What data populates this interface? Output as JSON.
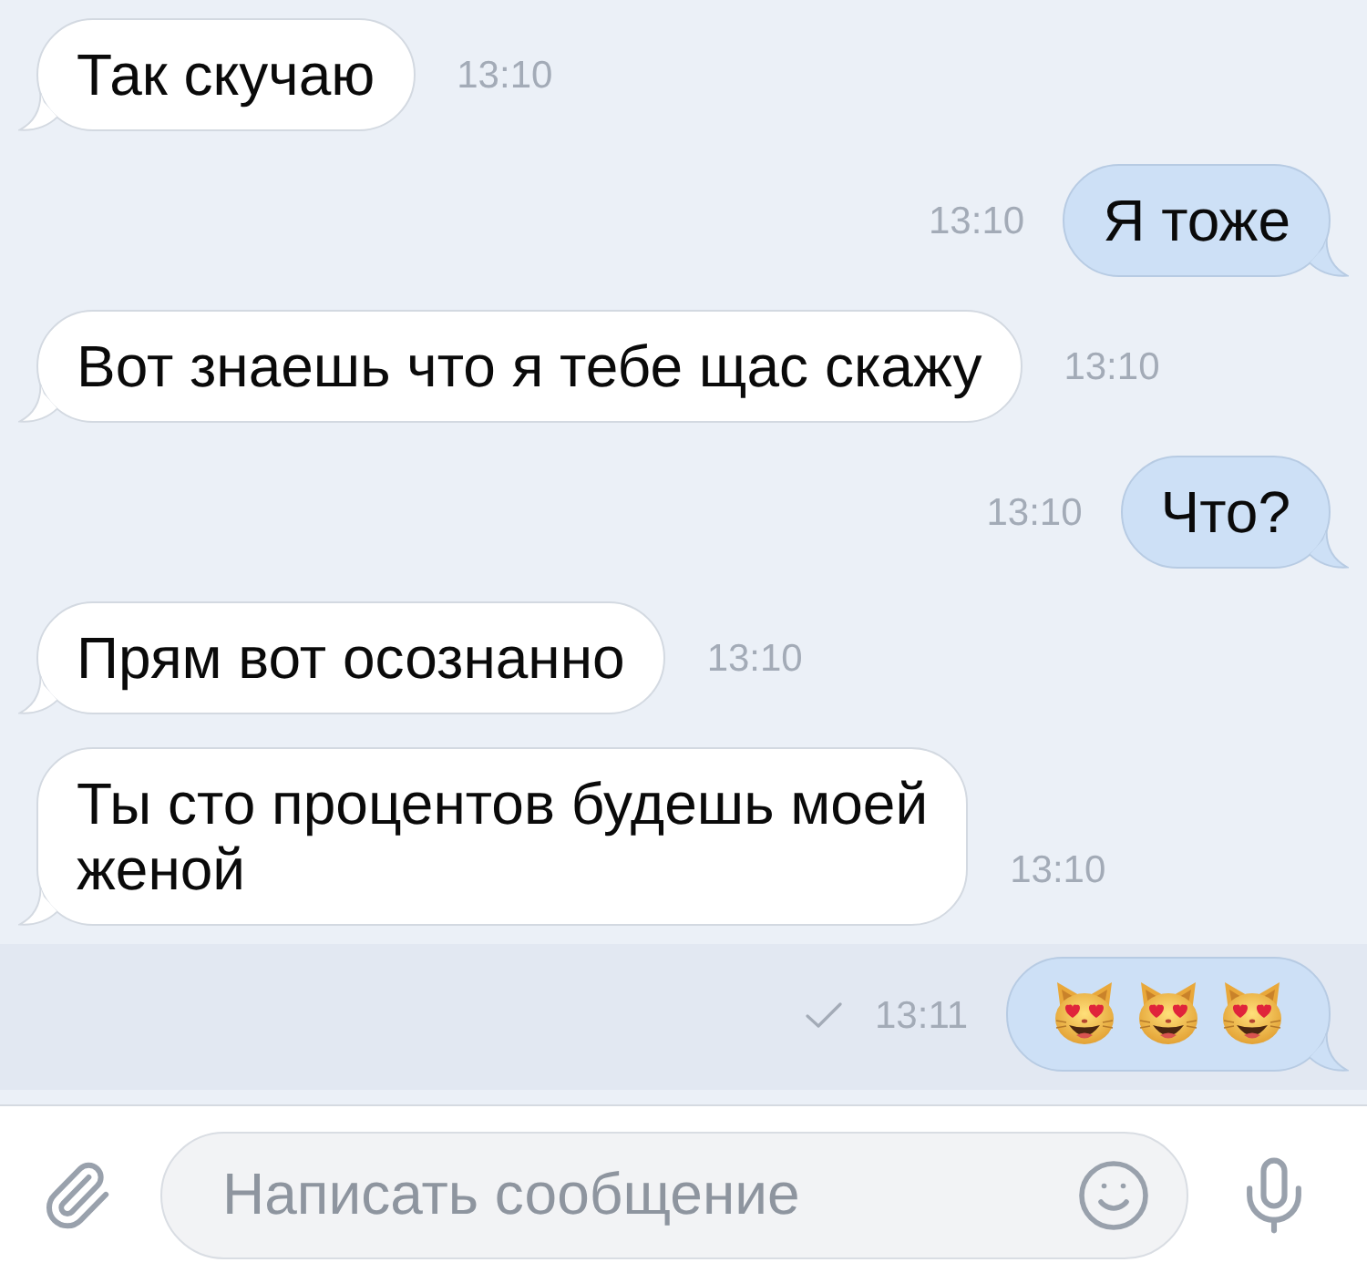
{
  "messages": [
    {
      "kind": "incoming",
      "text": "Так скучаю",
      "time": "13:10"
    },
    {
      "kind": "outgoing",
      "text": "Я тоже",
      "time": "13:10"
    },
    {
      "kind": "incoming",
      "text": "Вот знаешь что я тебе щас скажу",
      "time": "13:10"
    },
    {
      "kind": "outgoing",
      "text": "Что?",
      "time": "13:10"
    },
    {
      "kind": "incoming",
      "text": "Прям вот осознанно",
      "time": "13:10"
    },
    {
      "kind": "incoming",
      "text": "Ты сто процентов будешь моей\nженой",
      "time": "13:10"
    },
    {
      "kind": "outgoing",
      "time": "13:11",
      "unread": true,
      "sent": true,
      "emojis": [
        {
          "kind": "heart-eyes-cat"
        },
        {
          "kind": "heart-eyes-cat"
        },
        {
          "kind": "heart-eyes-cat"
        }
      ]
    }
  ],
  "composer": {
    "placeholder": "Написать сообщение"
  }
}
